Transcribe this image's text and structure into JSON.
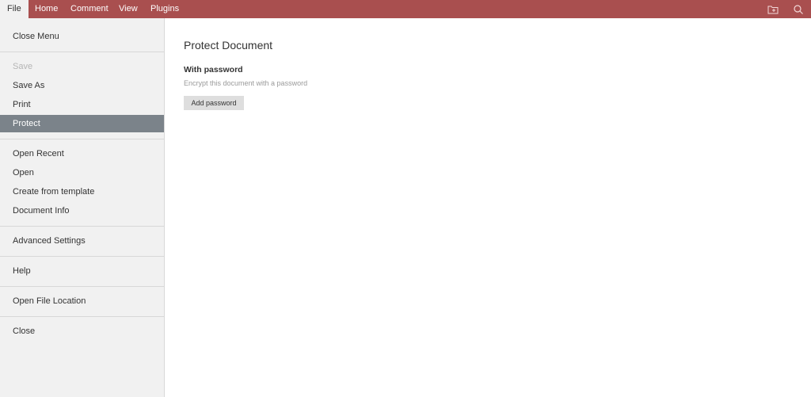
{
  "topbar": {
    "tabs": [
      {
        "label": "File"
      },
      {
        "label": "Home"
      },
      {
        "label": "Comment"
      },
      {
        "label": "View"
      },
      {
        "label": "Plugins"
      }
    ],
    "icons": [
      "folder-icon",
      "search-icon"
    ],
    "color": "#a94f4f"
  },
  "sidebar": {
    "items": [
      {
        "label": "Close Menu"
      },
      {
        "label": "Save"
      },
      {
        "label": "Save As"
      },
      {
        "label": "Print"
      },
      {
        "label": "Protect"
      },
      {
        "label": "Open Recent"
      },
      {
        "label": "Open"
      },
      {
        "label": "Create from template"
      },
      {
        "label": "Document Info"
      },
      {
        "label": "Advanced Settings"
      },
      {
        "label": "Help"
      },
      {
        "label": "Open File Location"
      },
      {
        "label": "Close"
      }
    ],
    "selected": "Protect",
    "selected_color": "#7b838a"
  },
  "content": {
    "title": "Protect Document",
    "section_title": "With password",
    "section_desc": "Encrypt this document with a password",
    "button_label": "Add password"
  }
}
